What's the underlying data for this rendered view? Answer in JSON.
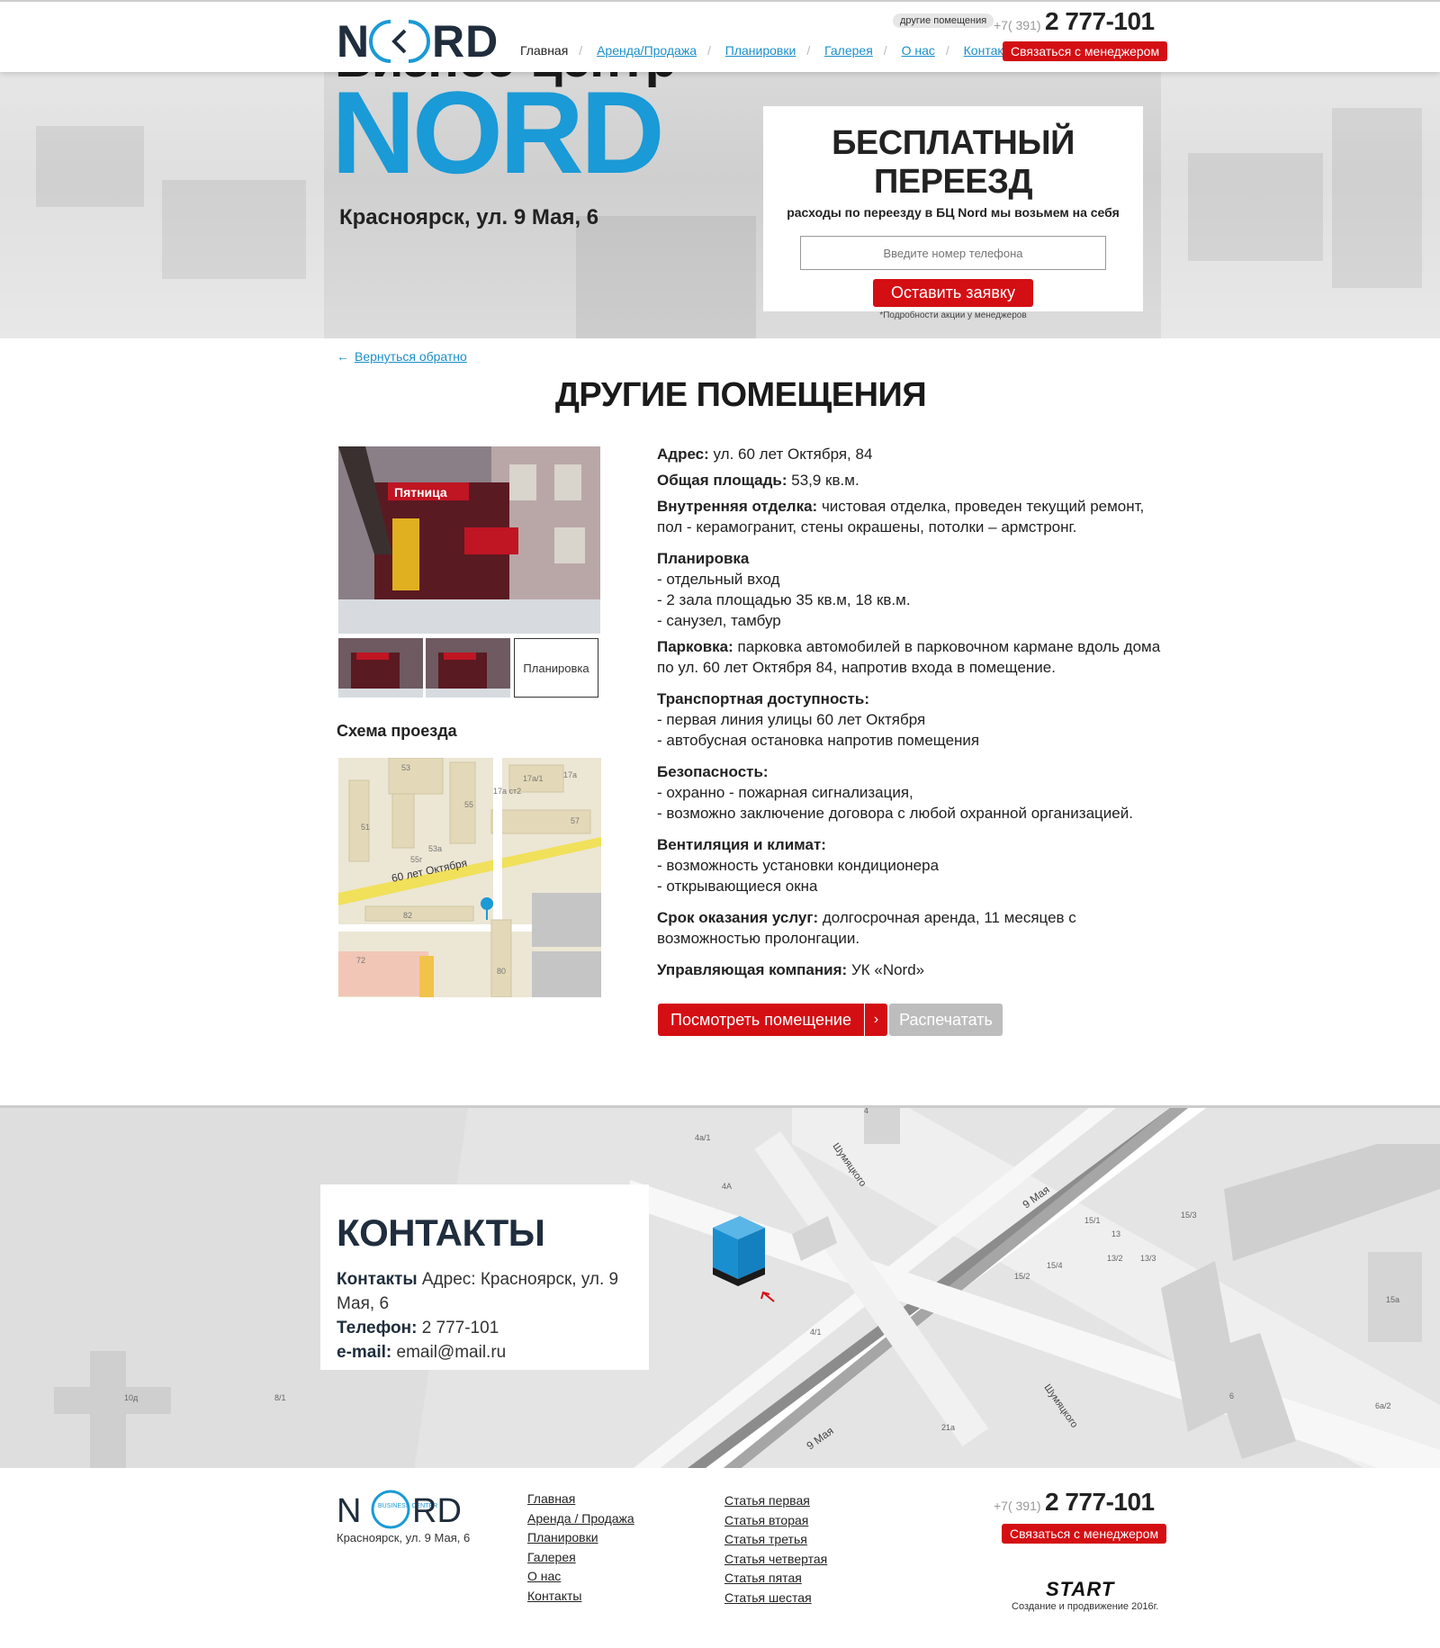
{
  "header": {
    "logo_text": "N(<)RD",
    "nav": [
      {
        "label": "Главная",
        "active": true
      },
      {
        "label": "Аренда/Продажа"
      },
      {
        "label": "Планировки"
      },
      {
        "label": "Галерея"
      },
      {
        "label": "О нас"
      },
      {
        "label": "Контакты"
      }
    ],
    "other_rooms_pill": "другие помещения",
    "phone_code": "+7( 391)",
    "phone": "2 777-101",
    "contact_button": "Связаться с менеджером"
  },
  "hero": {
    "title": "Бизнес-центр",
    "brand": "NORD",
    "address": "Красноярск, ул. 9 Мая, 6",
    "promo": {
      "title": "БЕСПЛАТНЫЙ ПЕРЕЕЗД",
      "subtitle": "расходы по переезду в БЦ Nord мы возьмем на себя",
      "phone_placeholder": "Введите номер телефона",
      "button": "Оставить заявку",
      "note": "*Подробности акции у менеджеров"
    }
  },
  "main": {
    "back_link": "Вернуться обратно",
    "page_title": "ДРУГИЕ ПОМЕЩЕНИЯ",
    "plan_thumb_label": "Планировка",
    "scheme_title": "Схема проезда",
    "photo_sign_text": "Пятница",
    "map_labels": {
      "street": "60 лет Октября",
      "b53": "53",
      "b51": "51",
      "b55": "55",
      "b57": "57",
      "b53a": "53а",
      "b55g": "55г",
      "b82": "82",
      "b72": "72",
      "b80": "80",
      "b17a1": "17а/1",
      "b17a": "17а",
      "b17ast2": "17а ст2"
    },
    "details": {
      "address_label": "Адрес:",
      "address": "ул. 60 лет Октября, 84",
      "area_label": "Общая площадь:",
      "area": "53,9 кв.м.",
      "finish_label": "Внутренняя отделка:",
      "finish": "чистовая отделка, проведен текущий ремонт, пол - керамогранит, стены окрашены, потолки – армстронг.",
      "layout_label": "Планировка",
      "layout_items": [
        "- отдельный вход",
        "- 2 зала площадью 35 кв.м, 18 кв.м.",
        "- санузел, тамбур"
      ],
      "parking_label": "Парковка:",
      "parking": "парковка автомобилей в парковочном кармане вдоль дома по ул. 60 лет Октября 84, напротив входа в помещение.",
      "transport_label": "Транспортная доступность:",
      "transport_items": [
        "- первая линия улицы 60 лет Октября",
        "- автобусная остановка напротив помещения"
      ],
      "security_label": "Безопасность:",
      "security_items": [
        "- охранно - пожарная сигнализация,",
        "- возможно заключение договора с любой охранной организацией."
      ],
      "vent_label": "Вентиляция и климат:",
      "vent_items": [
        "- возможность установки кондиционера",
        "- открывающиеся окна"
      ],
      "term_label": "Срок оказания услуг:",
      "term": "долгосрочная аренда, 11 месяцев с возможностью пролонгации.",
      "mgmt_label": "Управляющая компания:",
      "mgmt": "УК «Nord»"
    },
    "view_button": "Посмотреть помещение",
    "print_button": "Распечатать"
  },
  "contacts": {
    "title": "КОНТАКТЫ",
    "contacts_label": "Контакты",
    "address": "Адрес: Красноярск, ул. 9 Мая, 6",
    "phone_label": "Телефон:",
    "phone": "2 777-101",
    "email_label": "e-mail:",
    "email": "email@mail.ru",
    "map_labels": {
      "street1": "9 Мая",
      "street2": "Шумяцкого",
      "b4a1": "4а/1",
      "b4a": "4А",
      "b41": "4/1",
      "b151": "15/1",
      "b13": "13",
      "b132": "13/2",
      "b133": "13/3",
      "b153": "15/3",
      "b154": "15/4",
      "b152": "15/2",
      "b15a": "15а",
      "b10d": "10д",
      "b81": "8/1",
      "b6": "6",
      "b21a": "21а",
      "b6a2": "6а/2",
      "b4": "4"
    }
  },
  "footer": {
    "logo_badge": "BUSINESS CENTER",
    "address": "Красноярск, ул. 9 Мая, 6",
    "col1": [
      "Главная",
      "Аренда / Продажа",
      "Планировки",
      "Галерея",
      "О нас",
      "Контакты"
    ],
    "col2": [
      "Статья первая",
      "Статья вторая",
      "Статья третья",
      "Статья четвертая",
      "Статья пятая",
      "Статья шестая"
    ],
    "phone_code": "+7( 391)",
    "phone": "2 777-101",
    "contact_button": "Связаться с менеджером",
    "start_logo": "START",
    "start_note": "Создание и продвижение 2016г."
  },
  "colors": {
    "accent": "#1a9ad6",
    "brand_red": "#d40f14",
    "dark": "#1f2d3d"
  }
}
